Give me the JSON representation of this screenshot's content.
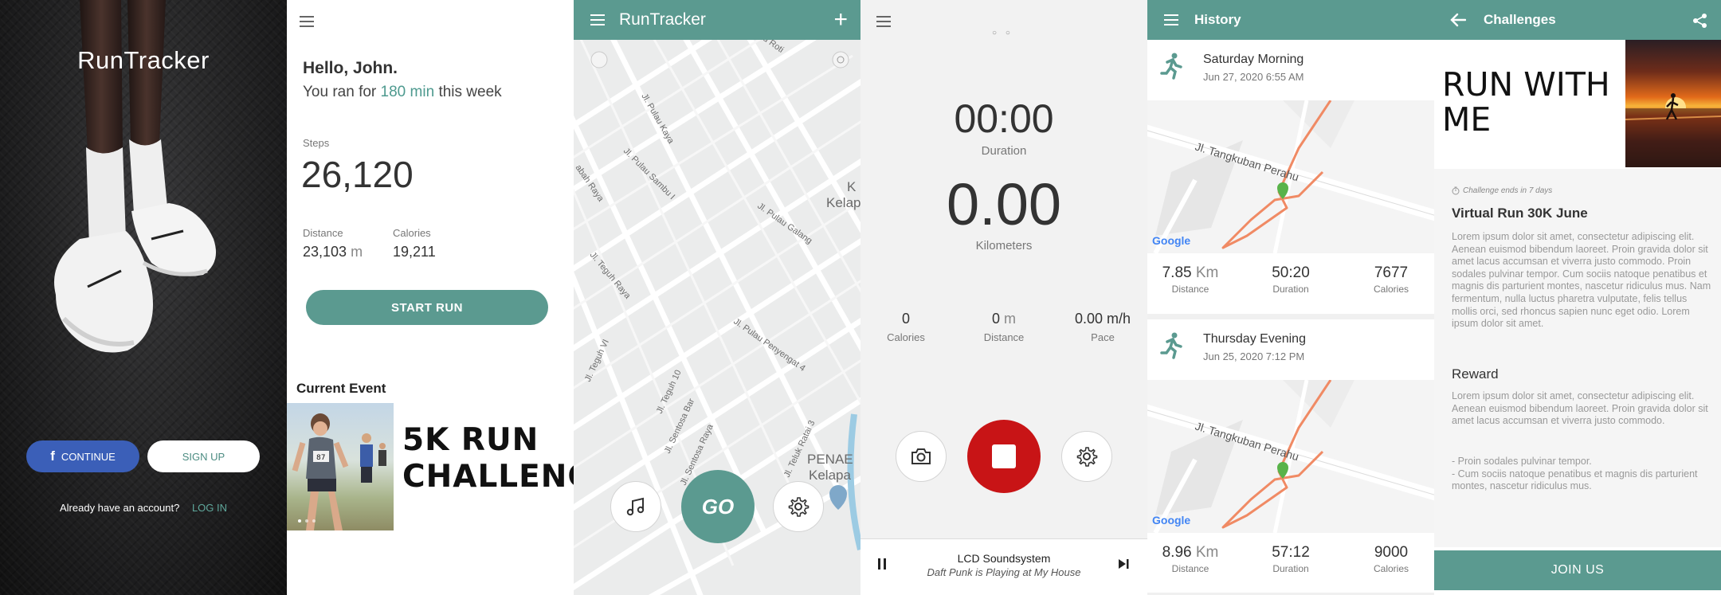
{
  "splash": {
    "logo": "RunTracker",
    "continue_label": "CONTINUE",
    "signup_label": "SIGN UP",
    "have_account": "Already have an account?",
    "login_label": "LOG IN"
  },
  "home": {
    "greeting": "Hello, John.",
    "ran_prefix": "You ran for",
    "ran_value": "180 min",
    "ran_suffix": "this week",
    "steps_label": "Steps",
    "steps_value": "26,120",
    "distance_label": "Distance",
    "distance_value": "23,103",
    "distance_unit": "m",
    "calories_label": "Calories",
    "calories_value": "19,211",
    "start_label": "START RUN",
    "event_heading": "Current Event",
    "event_title_line1": "5K RUN",
    "event_title_line2": "CHALLENGE",
    "runner_bib": "87"
  },
  "map_screen": {
    "title": "RunTracker",
    "go_label": "GO",
    "streets": [
      "Jl. Pulau Kaya",
      "Jl. Pulau Sambu I",
      "abah Raya",
      "Jl. Pulau Galang",
      "Jl. Teguh Raya",
      "Jl. Teguh VI",
      "Jl. Teguh 10",
      "Jl. Sentosa Bar",
      "Jl. Sentosa Raya",
      "Jl. Teluk Ratai 3",
      "Jl. Pulau Penyengat 4",
      "lau Roti"
    ],
    "places": [
      "K",
      "Kelap",
      "PENAE",
      "Kelapa"
    ]
  },
  "running": {
    "pager": "○ ○",
    "duration_value": "00:00",
    "duration_label": "Duration",
    "km_value": "0.00",
    "km_label": "Kilometers",
    "calories_value": "0",
    "calories_label": "Calories",
    "distance_value": "0",
    "distance_unit": "m",
    "distance_label": "Distance",
    "pace_value": "0.00 m/h",
    "pace_label": "Pace",
    "song": "LCD Soundsystem",
    "artist": "Daft Punk is Playing at My House"
  },
  "history": {
    "title": "History",
    "map_logo": "Google",
    "street": "Jl. Tangkuban Perahu",
    "runs": [
      {
        "title": "Saturday Morning",
        "date": "Jun 27, 2020  6:55 AM",
        "distance_value": "7.85",
        "distance_unit": "Km",
        "distance_label": "Distance",
        "duration_value": "50:20",
        "duration_label": "Duration",
        "calories_value": "7677",
        "calories_label": "Calories"
      },
      {
        "title": "Thursday Evening",
        "date": "Jun 25, 2020  7:12 PM",
        "distance_value": "8.96",
        "distance_unit": "Km",
        "distance_label": "Distance",
        "duration_value": "57:12",
        "duration_label": "Duration",
        "calories_value": "9000",
        "calories_label": "Calories"
      }
    ]
  },
  "challenges": {
    "title": "Challenges",
    "banner_line1": "RUN WITH",
    "banner_line2": "ME",
    "ends_text": "Challenge ends in 7 days",
    "challenge_title": "Virtual Run 30K June",
    "description": "Lorem ipsum dolor sit amet, consectetur adipiscing elit. Aenean euismod bibendum laoreet. Proin gravida dolor sit amet lacus accumsan et viverra justo commodo. Proin sodales pulvinar tempor. Cum sociis natoque penatibus et magnis dis parturient montes, nascetur ridiculus mus. Nam fermentum, nulla luctus pharetra vulputate, felis tellus mollis orci, sed rhoncus sapien nunc eget odio. Lorem ipsum dolor sit amet.",
    "reward_title": "Reward",
    "reward_text": "Lorem ipsum dolor sit amet, consectetur adipiscing elit. Aenean euismod bibendum laoreet. Proin gravida dolor sit amet lacus accumsan et viverra justo commodo.",
    "reward_list_1": "- Proin sodales pulvinar tempor.",
    "reward_list_2": "- Cum sociis natoque penatibus et magnis dis parturient montes, nascetur ridiculus mus.",
    "join_label": "JOIN US"
  },
  "colors": {
    "brand": "#5b9a90",
    "facebook": "#3b5fb8",
    "stop": "#c81416",
    "route": "#f08a64"
  }
}
